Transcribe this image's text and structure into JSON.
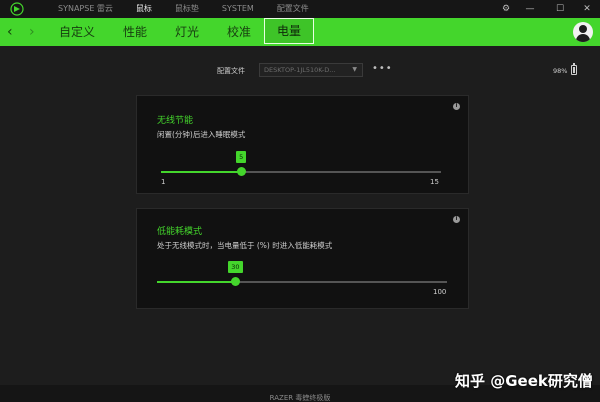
{
  "titlebar": {
    "tabs": [
      {
        "label": "SYNAPSE 雷云",
        "active": false
      },
      {
        "label": "鼠标",
        "active": true
      },
      {
        "label": "鼠标垫",
        "active": false
      },
      {
        "label": "SYSTEM",
        "active": false
      },
      {
        "label": "配置文件",
        "active": false
      }
    ],
    "controls": {
      "settings": "⚙",
      "minimize": "—",
      "maximize": "☐",
      "close": "✕"
    }
  },
  "navbar": {
    "back": "‹",
    "forward": "›",
    "tabs": [
      {
        "label": "自定义",
        "active": false
      },
      {
        "label": "性能",
        "active": false
      },
      {
        "label": "灯光",
        "active": false
      },
      {
        "label": "校准",
        "active": false
      },
      {
        "label": "电量",
        "active": true
      }
    ]
  },
  "profile": {
    "label": "配置文件",
    "value": "DESKTOP-1JL510K-D...",
    "more": "•••"
  },
  "battery": {
    "percent_text": "98%"
  },
  "sleep_card": {
    "title": "无线节能",
    "description": "闲置(分钟)后进入睡眠模式",
    "value": "5",
    "min": "1",
    "max": "15",
    "fraction": 0.286
  },
  "low_power_card": {
    "title": "低能耗模式",
    "description": "处于无线模式时，当电量低于 (%) 时进入低能耗模式",
    "value": "30",
    "max": "100",
    "fraction": 0.27
  },
  "footer": {
    "label": "RAZER 毒蝰终极版"
  },
  "watermark": "知乎 @Geek研究僧",
  "colors": {
    "accent": "#44d62c",
    "background": "#1d1d1d",
    "card": "#111111"
  }
}
